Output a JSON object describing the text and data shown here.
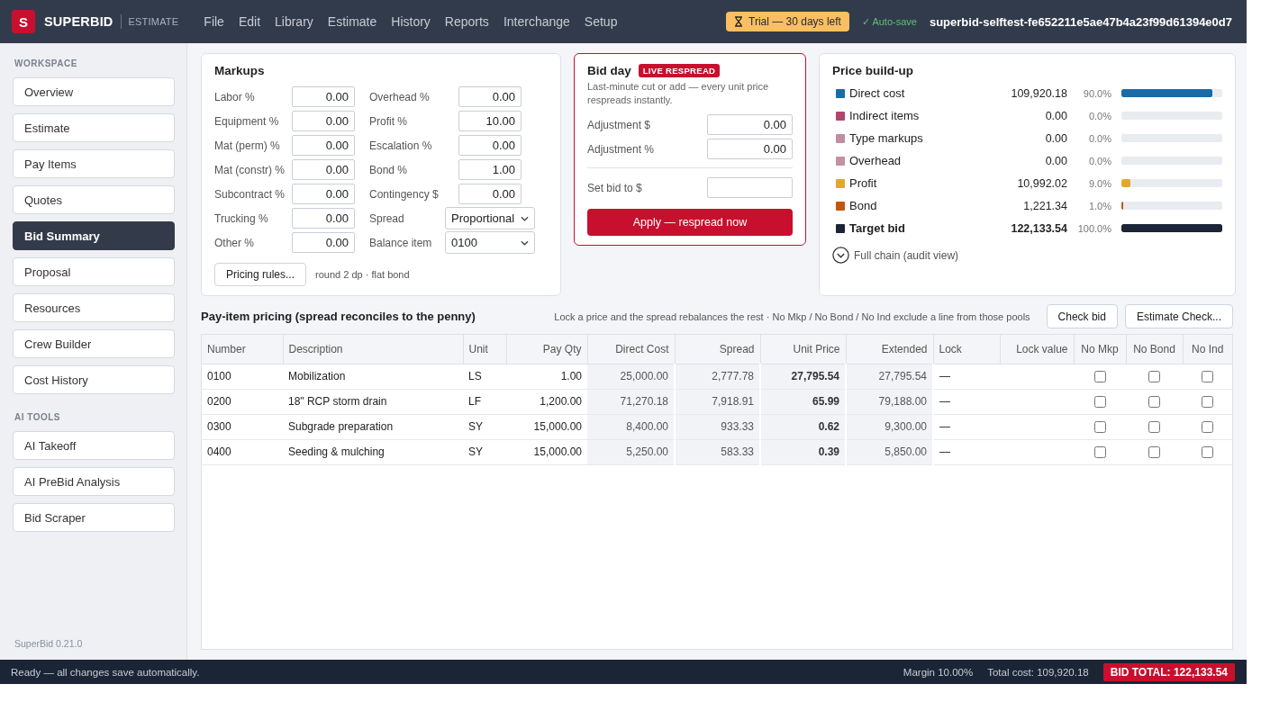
{
  "topbar": {
    "logo_letter": "S",
    "brand": "SUPERBID",
    "product": "ESTIMATE",
    "menu": [
      "File",
      "Edit",
      "Library",
      "Estimate",
      "History",
      "Reports",
      "Interchange",
      "Setup"
    ],
    "trial": "Trial — 30 days left",
    "autosave": "✓ Auto-save",
    "project": "superbid-selftest-fe652211e5ae47b4a23f99d61394e0d7"
  },
  "sidebar": {
    "sections": [
      {
        "title": "WORKSPACE",
        "items": [
          {
            "label": "Overview",
            "selected": false
          },
          {
            "label": "Estimate",
            "selected": false
          },
          {
            "label": "Pay Items",
            "selected": false
          },
          {
            "label": "Quotes",
            "selected": false
          },
          {
            "label": "Bid Summary",
            "selected": true
          },
          {
            "label": "Proposal",
            "selected": false
          },
          {
            "label": "Resources",
            "selected": false
          },
          {
            "label": "Crew Builder",
            "selected": false
          },
          {
            "label": "Cost History",
            "selected": false
          }
        ]
      },
      {
        "title": "AI TOOLS",
        "items": [
          {
            "label": "AI Takeoff",
            "selected": false
          },
          {
            "label": "AI PreBid Analysis",
            "selected": false
          },
          {
            "label": "Bid Scraper",
            "selected": false
          }
        ]
      }
    ],
    "version": "SuperBid 0.21.0"
  },
  "markups": {
    "title": "Markups",
    "columns": [
      [
        {
          "label": "Labor %",
          "kind": "number",
          "value": "0.00"
        },
        {
          "label": "Equipment %",
          "kind": "number",
          "value": "0.00"
        },
        {
          "label": "Mat (perm) %",
          "kind": "number",
          "value": "0.00"
        },
        {
          "label": "Mat (constr) %",
          "kind": "number",
          "value": "0.00"
        },
        {
          "label": "Subcontract %",
          "kind": "number",
          "value": "0.00"
        },
        {
          "label": "Trucking %",
          "kind": "number",
          "value": "0.00"
        },
        {
          "label": "Other %",
          "kind": "number",
          "value": "0.00"
        }
      ],
      [
        {
          "label": "Overhead %",
          "kind": "number",
          "value": "0.00"
        },
        {
          "label": "Profit %",
          "kind": "number",
          "value": "10.00"
        },
        {
          "label": "Escalation %",
          "kind": "number",
          "value": "0.00"
        },
        {
          "label": "Bond %",
          "kind": "number",
          "value": "1.00"
        },
        {
          "label": "Contingency $",
          "kind": "number",
          "value": "0.00"
        },
        {
          "label": "Spread",
          "kind": "select",
          "value": "Proportional"
        },
        {
          "label": "Balance item",
          "kind": "select",
          "value": "0100"
        }
      ]
    ],
    "rules_button": "Pricing rules...",
    "rules_note": "round 2 dp · flat bond"
  },
  "bid_day": {
    "title": "Bid day",
    "badge": "LIVE RESPREAD",
    "description": "Last-minute cut or add — every unit price respreads instantly.",
    "adjustments": [
      {
        "label": "Adjustment $",
        "value": "0.00"
      },
      {
        "label": "Adjustment %",
        "value": "0.00"
      }
    ],
    "set_bid": {
      "label": "Set bid to $"
    },
    "apply_button": "Apply — respread now"
  },
  "price_buildup": {
    "title": "Price build-up",
    "items": [
      {
        "label": "Direct cost",
        "kind": "component",
        "value": "109,920.18",
        "percent": "90.0%",
        "level": 0.9,
        "color": "#1a6ba8"
      },
      {
        "label": "Indirect items",
        "kind": "component",
        "value": "0.00",
        "percent": "0.0%",
        "color": "#b0466c"
      },
      {
        "label": "Type markups",
        "kind": "component",
        "value": "0.00",
        "percent": "0.0%",
        "color": "#c08da1"
      },
      {
        "label": "Overhead",
        "kind": "component",
        "value": "0.00",
        "percent": "0.0%",
        "color": "#c390a4"
      },
      {
        "label": "Profit",
        "kind": "component",
        "value": "10,992.02",
        "percent": "9.0%",
        "level": 0.09,
        "color": "#e2a82a"
      },
      {
        "label": "Bond",
        "kind": "component",
        "value": "1,221.34",
        "percent": "1.0%",
        "level": 0.01,
        "color": "#c0560f"
      },
      {
        "label": "Target bid",
        "kind": "total",
        "value": "122,133.54",
        "percent": "100.0%",
        "level": 1,
        "color": "#1b2536"
      }
    ],
    "audit_link": "Full chain (audit view)"
  },
  "pricing": {
    "title": "Pay-item pricing (spread reconciles to the penny)",
    "hint": "Lock a price and the spread rebalances the rest · No Mkp / No Bond / No Ind exclude a line from those pools",
    "buttons": [
      "Check bid",
      "Estimate Check..."
    ],
    "table": {
      "columns": [
        {
          "label": "Number",
          "kind": "text"
        },
        {
          "label": "Description",
          "kind": "text"
        },
        {
          "label": "Unit",
          "kind": "text"
        },
        {
          "label": "Pay Qty",
          "kind": "number"
        },
        {
          "label": "Direct Cost",
          "kind": "computed"
        },
        {
          "label": "Spread",
          "kind": "computed"
        },
        {
          "label": "Unit Price",
          "kind": "price"
        },
        {
          "label": "Extended",
          "kind": "computed"
        },
        {
          "label": "Lock",
          "kind": "text"
        },
        {
          "label": "Lock value",
          "kind": "entry"
        },
        {
          "label": "No Mkp",
          "kind": "check"
        },
        {
          "label": "No Bond",
          "kind": "check"
        },
        {
          "label": "No Ind",
          "kind": "check"
        }
      ],
      "rows": [
        {
          "values": [
            "0100",
            "Mobilization",
            "LS",
            "1.00",
            "25,000.00",
            "2,777.78",
            "27,795.54",
            "27,795.54",
            "—"
          ],
          "exclusions": [
            {
              "checked": false
            },
            {
              "checked": false
            },
            {
              "checked": false
            }
          ]
        },
        {
          "values": [
            "0200",
            "18\" RCP storm drain",
            "LF",
            "1,200.00",
            "71,270.18",
            "7,918.91",
            "65.99",
            "79,188.00",
            "—"
          ],
          "exclusions": [
            {
              "checked": false
            },
            {
              "checked": false
            },
            {
              "checked": false
            }
          ]
        },
        {
          "values": [
            "0300",
            "Subgrade preparation",
            "SY",
            "15,000.00",
            "8,400.00",
            "933.33",
            "0.62",
            "9,300.00",
            "—"
          ],
          "exclusions": [
            {
              "checked": false
            },
            {
              "checked": false
            },
            {
              "checked": false
            }
          ]
        },
        {
          "values": [
            "0400",
            "Seeding & mulching",
            "SY",
            "15,000.00",
            "5,250.00",
            "583.33",
            "0.39",
            "5,850.00",
            "—"
          ],
          "exclusions": [
            {
              "checked": false
            },
            {
              "checked": false
            },
            {
              "checked": false
            }
          ]
        }
      ]
    }
  },
  "status_bar": {
    "message": "Ready — all changes save automatically.",
    "margin": "Margin 10.00%",
    "total_cost": "Total cost: 109,920.18",
    "bid_total": "BID TOTAL: 122,133.54"
  }
}
